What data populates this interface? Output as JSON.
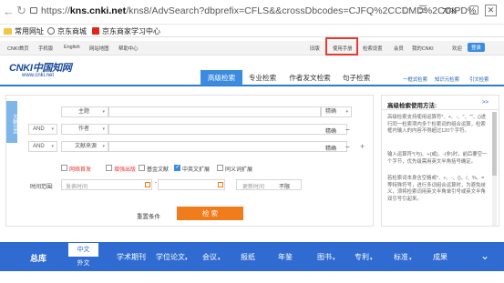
{
  "browser": {
    "url_prefix": "https://",
    "url_domain": "kns.cnki.net",
    "url_rest": "/kns8/AdvSearch?dbprefix=CFLS&&crossDbcodes=CJFQ%2CCDMD%2CCIPD%",
    "zoom": "70%",
    "bookmarks": [
      "常用网址",
      "京东商城",
      "京东商家学习中心"
    ]
  },
  "topnav": {
    "left": [
      "CNKI首页",
      "手机版",
      "English",
      "网站地图",
      "帮助中心"
    ],
    "right": [
      "旧版",
      "使用手册",
      "检索设置",
      "会员",
      "我的CNKI",
      "欢迎",
      "登录"
    ]
  },
  "logo": {
    "text": "CNKI中国知网",
    "sub": "www.cnki.net"
  },
  "tabs": [
    "高级检索",
    "专业检索",
    "作者发文检索",
    "句子检索"
  ],
  "right_links": [
    "一框式检索",
    "知识元检索",
    "引文检索"
  ],
  "sidebar_tag": "文献分类",
  "rows": [
    {
      "logic": "",
      "field": "主题",
      "match": "精确"
    },
    {
      "logic": "AND",
      "field": "作者",
      "match": "精确"
    },
    {
      "logic": "AND",
      "field": "文献来源",
      "match": "精确"
    }
  ],
  "checks": [
    {
      "label": "网络首发",
      "checked": false,
      "red": true
    },
    {
      "label": "增强出版",
      "checked": false,
      "red": true
    },
    {
      "label": "基金文献",
      "checked": false,
      "red": false
    },
    {
      "label": "中英文扩展",
      "checked": true,
      "red": false
    },
    {
      "label": "同义词扩展",
      "checked": false,
      "red": false
    }
  ],
  "time": {
    "label": "时间范围:",
    "start": "发表时间",
    "dash": "-",
    "update_label": "更新时间",
    "update_value": "不限"
  },
  "buttons": {
    "reset": "重置条件",
    "search": "检 索"
  },
  "help": {
    "title": "高级检索使用方法:",
    "more": ">>",
    "lines": [
      "高级检索支持使用运算符*、+、-、''、\"\"、()进行同一检索项内多个检索词的组合运算，检索框内输入的内容不得超过120个字符。",
      "输入运算符*(与)、+(或)、-(非)时，前后要空一个字节，优先级需用英文半角括号确定。",
      "若检索词本身含空格或*、+、-、()、/、%、=等特殊符号，进行多词组合运算时，为避免歧义，须将检索词用英文半角单引号或英文半角双引号引起来。"
    ]
  },
  "band": {
    "title": "总库",
    "lang": [
      "中文",
      "外文"
    ],
    "items": [
      "学术期刊",
      "学位论文",
      "会议",
      "报纸",
      "年鉴",
      "图书",
      "专利",
      "标准",
      "成果"
    ]
  },
  "colors": {
    "accent": "#3b8ce0",
    "band": "#2f6bd0",
    "search_button": "#f07c1b",
    "highlight_box": "#e53935"
  }
}
